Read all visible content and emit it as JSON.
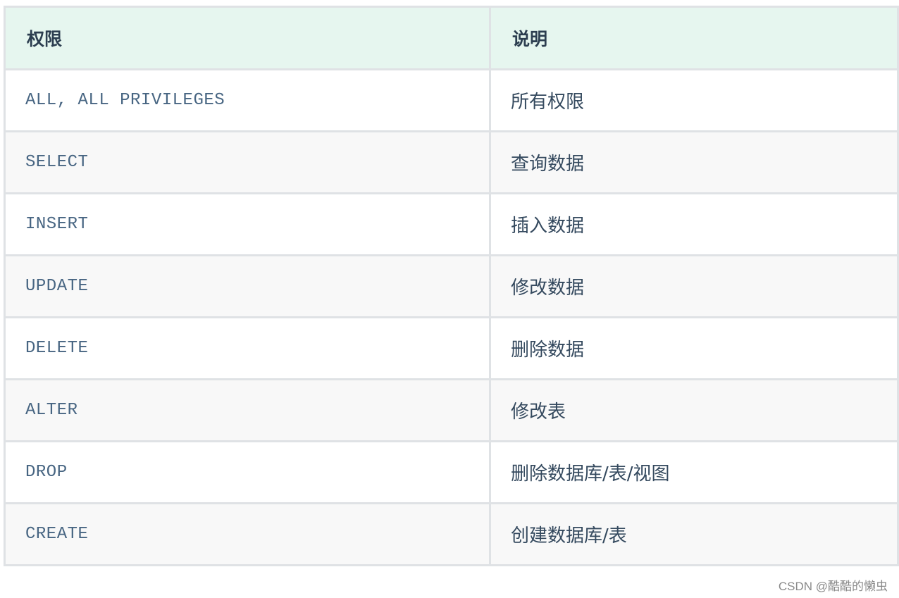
{
  "table": {
    "headers": [
      "权限",
      "说明"
    ],
    "rows": [
      {
        "privilege": "ALL, ALL PRIVILEGES",
        "description": "所有权限"
      },
      {
        "privilege": "SELECT",
        "description": "查询数据"
      },
      {
        "privilege": "INSERT",
        "description": "插入数据"
      },
      {
        "privilege": "UPDATE",
        "description": "修改数据"
      },
      {
        "privilege": "DELETE",
        "description": "删除数据"
      },
      {
        "privilege": "ALTER",
        "description": "修改表"
      },
      {
        "privilege": "DROP",
        "description": "删除数据库/表/视图"
      },
      {
        "privilege": "CREATE",
        "description": "创建数据库/表"
      }
    ]
  },
  "watermark": "CSDN @酷酷的懒虫",
  "colors": {
    "header_bg": "#e6f6ef",
    "border": "#dfe2e5",
    "row_alt_bg": "#f8f8f8",
    "code_text": "#476582",
    "body_text": "#34495e"
  }
}
